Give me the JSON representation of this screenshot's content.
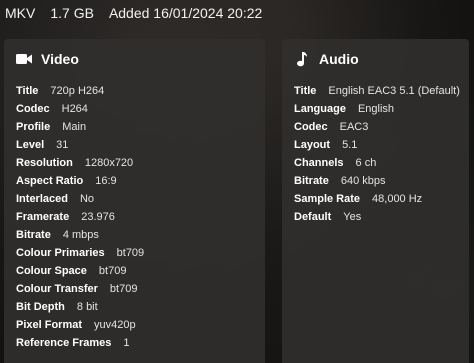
{
  "top_bar": {
    "container": "MKV",
    "size": "1.7 GB",
    "added": "Added 16/01/2024 20:22"
  },
  "video": {
    "title": "Video",
    "icon": "videocam-icon",
    "rows": [
      {
        "key": "Title",
        "value": "720p H264"
      },
      {
        "key": "Codec",
        "value": "H264"
      },
      {
        "key": "Profile",
        "value": "Main"
      },
      {
        "key": "Level",
        "value": "31"
      },
      {
        "key": "Resolution",
        "value": "1280x720"
      },
      {
        "key": "Aspect Ratio",
        "value": "16:9"
      },
      {
        "key": "Interlaced",
        "value": "No"
      },
      {
        "key": "Framerate",
        "value": "23.976"
      },
      {
        "key": "Bitrate",
        "value": "4 mbps"
      },
      {
        "key": "Colour Primaries",
        "value": "bt709"
      },
      {
        "key": "Colour Space",
        "value": "bt709"
      },
      {
        "key": "Colour Transfer",
        "value": "bt709"
      },
      {
        "key": "Bit Depth",
        "value": "8 bit"
      },
      {
        "key": "Pixel Format",
        "value": "yuv420p"
      },
      {
        "key": "Reference Frames",
        "value": "1"
      }
    ]
  },
  "audio": {
    "title": "Audio",
    "icon": "music-note-icon",
    "rows": [
      {
        "key": "Title",
        "value": "English EAC3 5.1 (Default)"
      },
      {
        "key": "Language",
        "value": "English"
      },
      {
        "key": "Codec",
        "value": "EAC3"
      },
      {
        "key": "Layout",
        "value": "5.1"
      },
      {
        "key": "Channels",
        "value": "6 ch"
      },
      {
        "key": "Bitrate",
        "value": "640 kbps"
      },
      {
        "key": "Sample Rate",
        "value": "48,000 Hz"
      },
      {
        "key": "Default",
        "value": "Yes"
      }
    ]
  }
}
